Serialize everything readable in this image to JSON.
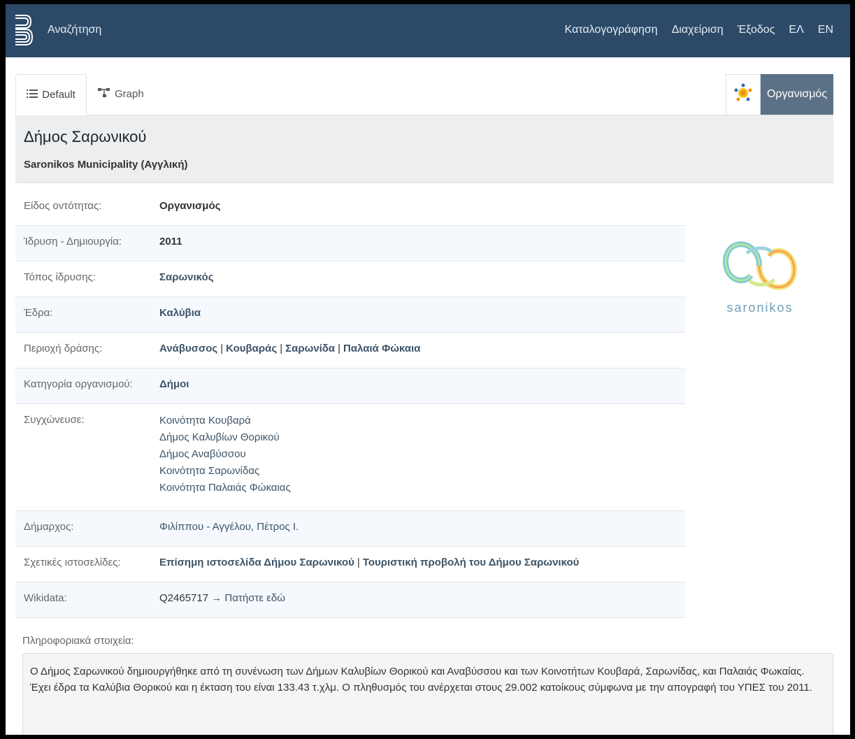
{
  "navbar": {
    "search": "Αναζήτηση",
    "links": [
      "Καταλογογράφηση",
      "Διαχείριση",
      "Έξοδος",
      "ΕΛ",
      "EN"
    ],
    "color": "#2c4a68"
  },
  "tabs": {
    "default_label": "Default",
    "graph_label": "Graph",
    "type_badge": "Οργανισμός"
  },
  "header": {
    "title": "Δήμος Σαρωνικού",
    "subtitle": "Saronikos Municipality (Αγγλική)"
  },
  "properties": [
    {
      "label": "Είδος οντότητας:",
      "value": "Οργανισμός"
    },
    {
      "label": "Ίδρυση - Δημιουργία:",
      "value": "2011"
    },
    {
      "label": "Τόπος ίδρυσης:",
      "value": "Σαρωνικός"
    },
    {
      "label": "Έδρα:",
      "value": "Καλύβια"
    },
    {
      "label": "Περιοχή δράσης:",
      "values": [
        "Ανάβυσσος",
        "Κουβαράς",
        "Σαρωνίδα",
        "Παλαιά Φώκαια"
      ]
    },
    {
      "label": "Κατηγορία οργανισμού:",
      "value": "Δήμοι"
    },
    {
      "label": "Συγχώνευσε:",
      "values": [
        "Κοινότητα Κουβαρά",
        "Δήμος Καλυβίων Θορικού",
        "Δήμος Αναβύσσου",
        "Κοινότητα Σαρωνίδας",
        "Κοινότητα Παλαιάς Φώκαιας"
      ]
    },
    {
      "label": "Δήμαρχος:",
      "value": "Φιλίππου - Αγγέλου, Πέτρος Ι."
    },
    {
      "label": "Σχετικές ιστοσελίδες:",
      "values": [
        "Επίσημη ιστοσελίδα Δήμου Σαρωνικού",
        "Τουριστική προβολή του Δήμου Σαρωνικού"
      ]
    },
    {
      "label": "Wikidata:",
      "id": "Q2465717",
      "link": "→ Πατήστε εδώ"
    }
  ],
  "logo_text": "saronikos",
  "info": {
    "label": "Πληροφοριακά στοιχεία:",
    "text": "Ο Δήμος Σαρωνικού δημιουργήθηκε από τη συνένωση των Δήμων Καλυβίων Θορικού και Αναβύσσου και των Κοινοτήτων Κουβαρά, Σαρωνίδας, και Παλαιάς Φωκαίας. Έχει έδρα τα Καλύβια Θορικού και η έκταση του είναι 133.43 τ.χλμ. Ο πληθυσμός του ανέρχεται στους 29.002 κατοίκους σύμφωνα με την απογραφή του ΥΠΕΣ του 2011."
  }
}
